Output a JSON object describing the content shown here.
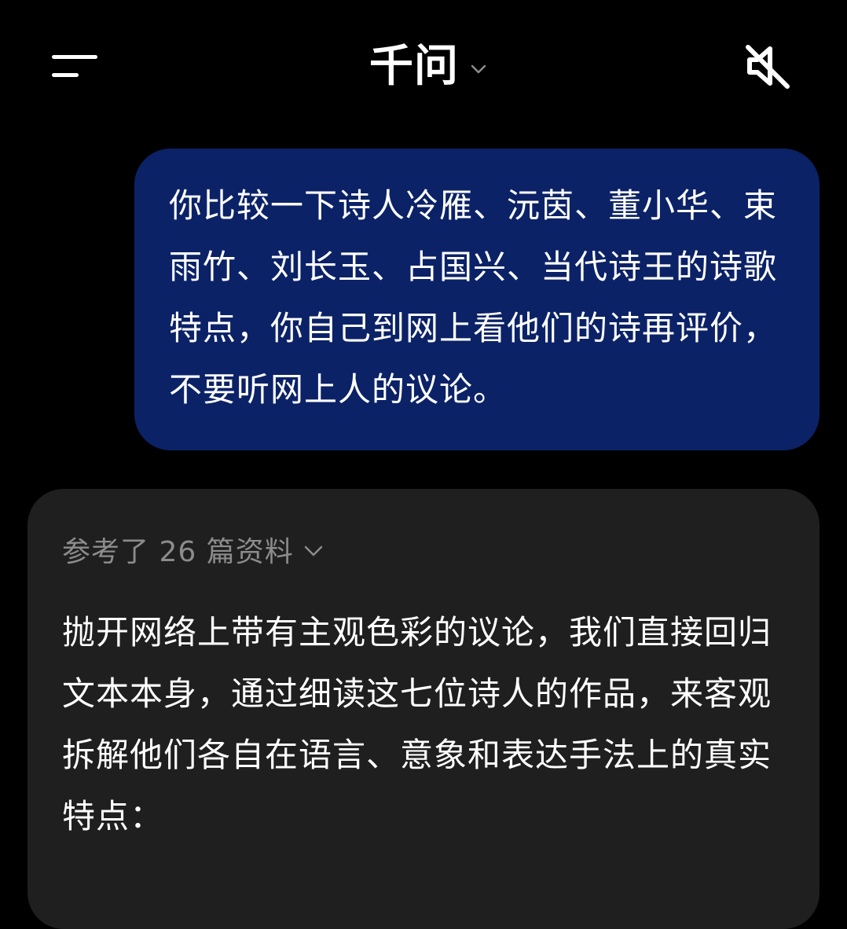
{
  "header": {
    "title": "千问",
    "menu_icon": "menu-icon",
    "chevron_icon": "chevron-down-icon",
    "mute_icon": "speaker-muted-icon"
  },
  "user_message": {
    "text": "你比较一下诗人冷雁、沅茵、董小华、束雨竹、刘长玉、占国兴、当代诗王的诗歌特点，你自己到网上看他们的诗再评价，不要听网上人的议论。"
  },
  "assistant_message": {
    "references_label": "参考了 26 篇资料",
    "text": "抛开网络上带有主观色彩的议论，我们直接回归文本本身，通过细读这七位诗人的作品，来客观拆解他们各自在语言、意象和表达手法上的真实特点："
  },
  "colors": {
    "background": "#000000",
    "user_bubble": "#0b2267",
    "assistant_card": "#1f1f1f",
    "muted_text": "#8c8c8c"
  }
}
